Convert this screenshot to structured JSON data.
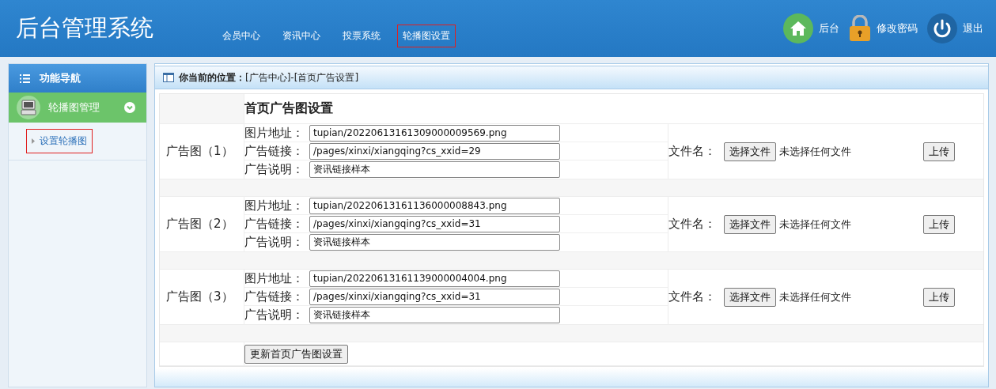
{
  "header": {
    "title": "后台管理系统",
    "nav": [
      {
        "label": "会员中心",
        "selected": false
      },
      {
        "label": "资讯中心",
        "selected": false
      },
      {
        "label": "投票系统",
        "selected": false
      },
      {
        "label": "轮播图设置",
        "selected": true
      }
    ],
    "actions": [
      {
        "kind": "home",
        "label": "后台"
      },
      {
        "kind": "lock",
        "label": "修改密码"
      },
      {
        "kind": "power",
        "label": "退出"
      }
    ]
  },
  "sidebar": {
    "heading": "功能导航",
    "group": {
      "label": "轮播图管理",
      "expanded": true,
      "items": [
        {
          "label": "设置轮播图",
          "selected": true
        }
      ]
    }
  },
  "breadcrumb": {
    "label": "你当前的位置：",
    "path": "[广告中心]-[首页广告设置]"
  },
  "form": {
    "title": "首页广告图设置",
    "ads": [
      {
        "label": "广告图（1）",
        "fields": [
          {
            "label": "图片地址：",
            "value": "tupian/20220613161309000009569.png"
          },
          {
            "label": "广告链接：",
            "value": "/pages/xinxi/xiangqing?cs_xxid=29"
          },
          {
            "label": "广告说明：",
            "value": "资讯链接样本"
          }
        ],
        "file_label": "文件名：",
        "choose_button": "选择文件",
        "file_status": "未选择任何文件",
        "upload_button": "上传"
      },
      {
        "label": "广告图（2）",
        "fields": [
          {
            "label": "图片地址：",
            "value": "tupian/20220613161136000008843.png"
          },
          {
            "label": "广告链接：",
            "value": "/pages/xinxi/xiangqing?cs_xxid=31"
          },
          {
            "label": "广告说明：",
            "value": "资讯链接样本"
          }
        ],
        "file_label": "文件名：",
        "choose_button": "选择文件",
        "file_status": "未选择任何文件",
        "upload_button": "上传"
      },
      {
        "label": "广告图（3）",
        "fields": [
          {
            "label": "图片地址：",
            "value": "tupian/20220613161139000004004.png"
          },
          {
            "label": "广告链接：",
            "value": "/pages/xinxi/xiangqing?cs_xxid=31"
          },
          {
            "label": "广告说明：",
            "value": "资讯链接样本"
          }
        ],
        "file_label": "文件名：",
        "choose_button": "选择文件",
        "file_status": "未选择任何文件",
        "upload_button": "上传"
      }
    ],
    "submit": "更新首页广告图设置"
  }
}
